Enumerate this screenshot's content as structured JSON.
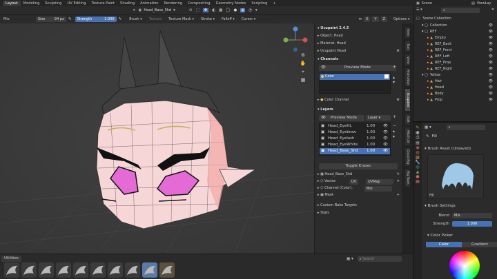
{
  "menubar": {
    "tabs": [
      "Layout",
      "Modeling",
      "Sculpting",
      "UV Editing",
      "Texture Paint",
      "Shading",
      "Animation",
      "Rendering",
      "Compositing",
      "Geometry Nodes",
      "Scripting"
    ],
    "active_tab": "Layout",
    "brush_name": "Head_Base_Shd",
    "scene": "Scene",
    "view_layer": "ViewLay"
  },
  "toolbar": {
    "blend_mode": "Mix",
    "size_label": "Size",
    "size_value": "94 px",
    "strength_label": "Strength",
    "strength_value": "1.000",
    "menus": [
      "Brush",
      "Texture",
      "Texture Mask",
      "Stroke",
      "Falloff",
      "Cursor"
    ],
    "axis_labels": [
      "X",
      "Y",
      "Z"
    ],
    "options_label": "Options"
  },
  "npanel": {
    "addon_title": "Ucupaint 2.4.5",
    "object_label": "Object: Head",
    "material_label": "Material: Head",
    "ucupaint_node": "Ucupaint Head",
    "channels_header": "Channels",
    "preview_mode_label": "Preview Mode",
    "channel_item": "Color",
    "color_channel_label": "Color Channel",
    "layers_header": "Layers",
    "layer_dropdown": "Layer",
    "layers": [
      {
        "name": "Head_EyeHL",
        "value": "1.00"
      },
      {
        "name": "Head_Eyebrow",
        "value": "1.00"
      },
      {
        "name": "Head_Eyelash",
        "value": "1.00"
      },
      {
        "name": "Head_EyeWhite",
        "value": "1.00"
      },
      {
        "name": "Head_Base_Shd",
        "value": "1.00"
      }
    ],
    "toggle_eraser": "Toggle Eraser",
    "active_layer": "Head_Base_Shd",
    "vector_label": "Vector:",
    "vector_value": "UV",
    "uv_map": "UVMap",
    "channel_color_label": "Channel (Color):",
    "channel_color_value": "Mix",
    "mask_label": "Mask",
    "custom_bake": "Custom Bake Targets",
    "stats": "Stats",
    "vertical_tabs": [
      "Item",
      "Tool",
      "View",
      "Ucupaint",
      "Edit",
      "Animation",
      "Rig Tools",
      "Mio3 UV",
      "Cloud Rig"
    ]
  },
  "outliner": {
    "search_placeholder": "",
    "title": "Scene Collection",
    "items": [
      {
        "name": "Collection",
        "indent": 1,
        "kind": "collection"
      },
      {
        "name": "REF",
        "indent": 1,
        "kind": "collection"
      },
      {
        "name": "Empty",
        "indent": 2,
        "kind": "object"
      },
      {
        "name": "REF_Back",
        "indent": 2,
        "kind": "object"
      },
      {
        "name": "REF_Front",
        "indent": 2,
        "kind": "object"
      },
      {
        "name": "REF_Left",
        "indent": 2,
        "kind": "object"
      },
      {
        "name": "REF_Prop",
        "indent": 2,
        "kind": "object"
      },
      {
        "name": "REF_Right",
        "indent": 2,
        "kind": "object"
      },
      {
        "name": "Yellow",
        "indent": 1,
        "kind": "collection"
      },
      {
        "name": "Hair",
        "indent": 2,
        "kind": "object"
      },
      {
        "name": "Head",
        "indent": 2,
        "kind": "object"
      },
      {
        "name": "Body",
        "indent": 2,
        "kind": "object"
      },
      {
        "name": "Prop",
        "indent": 2,
        "kind": "object"
      }
    ]
  },
  "properties": {
    "brush_label": "Fill",
    "brush_asset": "Brush Asset (Unsaved)",
    "asset_label": "Fill",
    "brush_settings": "Brush Settings",
    "blend_label": "Blend",
    "blend_value": "Mix",
    "strength_label": "Strength",
    "strength_value": "1.000",
    "color_picker": "Color Picker",
    "color_tab": "Color",
    "gradient_tab": "Gradient"
  },
  "shelf": {
    "label": "Utilities",
    "search_placeholder": "Search",
    "brush_count": 10
  },
  "colors": {
    "accent": "#4772b3",
    "skin": "#f6d6d6",
    "eye": "#e46bd6",
    "horn": "#4d4d4d"
  }
}
